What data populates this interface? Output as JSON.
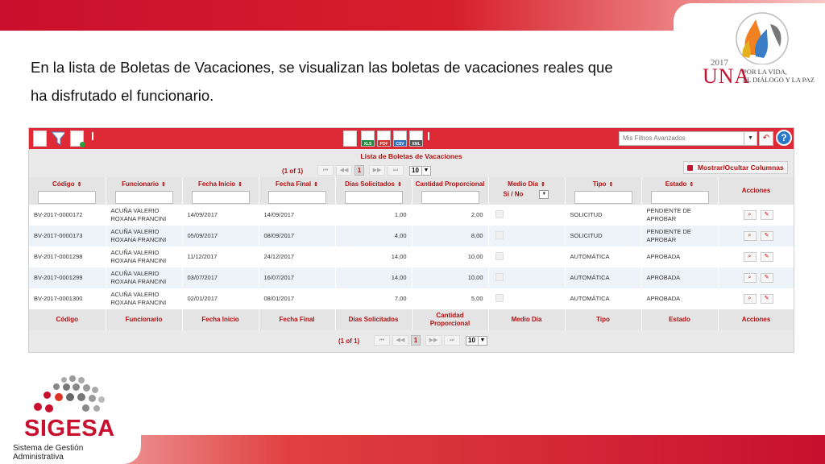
{
  "slide": {
    "intro_line1": "En la lista de Boletas de Vacaciones, se visualizan las boletas de vacaciones reales que",
    "intro_line2": "ha disfrutado el funcionario.",
    "una_logo": {
      "year": "2017",
      "acronym": "UNA",
      "motto_line1": "POR LA VIDA,",
      "motto_line2": "EL DIÁLOGO Y LA PAZ"
    },
    "sigesa_logo": {
      "name": "SIGESA",
      "subtitle": "Sistema de Gestión Administrativa"
    }
  },
  "toolbar": {
    "left_icons": [
      "new-document-icon",
      "filter-icon",
      "export-document-icon"
    ],
    "formats": [
      {
        "label": "XLS",
        "color": "#1e8a3c"
      },
      {
        "label": "PDF",
        "color": "#d0302a"
      },
      {
        "label": "CSV",
        "color": "#2a6fbf"
      },
      {
        "label": "XML",
        "color": "#555555"
      }
    ],
    "filter_placeholder": "Mis Filtros Avanzados",
    "help_label": "?"
  },
  "table_caption": "Lista de Boletas de Vacaciones",
  "pagination": {
    "page_info": "(1 of 1)",
    "current_page": "1",
    "rows_per_page": "10",
    "first": "⏮",
    "prev": "◀◀",
    "next": "▶▶",
    "last": "⏭"
  },
  "toggle_columns_label": "Mostrar/Ocultar Columnas",
  "columns": [
    "Código",
    "Funcionario",
    "Fecha Inicio",
    "Fecha Final",
    "Días Solicitados",
    "Cantidad Proporcional",
    "Medio Día",
    "Tipo",
    "Estado",
    "Acciones"
  ],
  "footer_columns": [
    "Código",
    "Funcionario",
    "Fecha Inicio",
    "Fecha Final",
    "Días Solicitados",
    "Cantidad Proporcional",
    "Medio Día",
    "Tipo",
    "Estado",
    "Acciones"
  ],
  "medio_dia_filter": "Si / No",
  "rows": [
    {
      "codigo": "BV-2017-0000172",
      "funcionario1": "ACUÑA VALERIO",
      "funcionario2": "ROXANA FRANCINI",
      "inicio": "14/09/2017",
      "final": "14/09/2017",
      "dias": "1,00",
      "cantidad": "2,00",
      "tipo": "SOLICITUD",
      "estado1": "PENDIENTE DE",
      "estado2": "APROBAR"
    },
    {
      "codigo": "BV-2017-0000173",
      "funcionario1": "ACUÑA VALERIO",
      "funcionario2": "ROXANA FRANCINI",
      "inicio": "05/09/2017",
      "final": "08/09/2017",
      "dias": "4,00",
      "cantidad": "8,00",
      "tipo": "SOLICITUD",
      "estado1": "PENDIENTE DE",
      "estado2": "APROBAR"
    },
    {
      "codigo": "BV-2017-0001298",
      "funcionario1": "ACUÑA VALERIO",
      "funcionario2": "ROXANA FRANCINI",
      "inicio": "11/12/2017",
      "final": "24/12/2017",
      "dias": "14,00",
      "cantidad": "10,00",
      "tipo": "AUTOMÁTICA",
      "estado1": "APROBADA",
      "estado2": ""
    },
    {
      "codigo": "BV-2017-0001299",
      "funcionario1": "ACUÑA VALERIO",
      "funcionario2": "ROXANA FRANCINI",
      "inicio": "03/07/2017",
      "final": "16/07/2017",
      "dias": "14,00",
      "cantidad": "10,00",
      "tipo": "AUTOMÁTICA",
      "estado1": "APROBADA",
      "estado2": ""
    },
    {
      "codigo": "BV-2017-0001300",
      "funcionario1": "ACUÑA VALERIO",
      "funcionario2": "ROXANA FRANCINI",
      "inicio": "02/01/2017",
      "final": "08/01/2017",
      "dias": "7,00",
      "cantidad": "5,00",
      "tipo": "AUTOMÁTICA",
      "estado1": "APROBADA",
      "estado2": ""
    }
  ]
}
